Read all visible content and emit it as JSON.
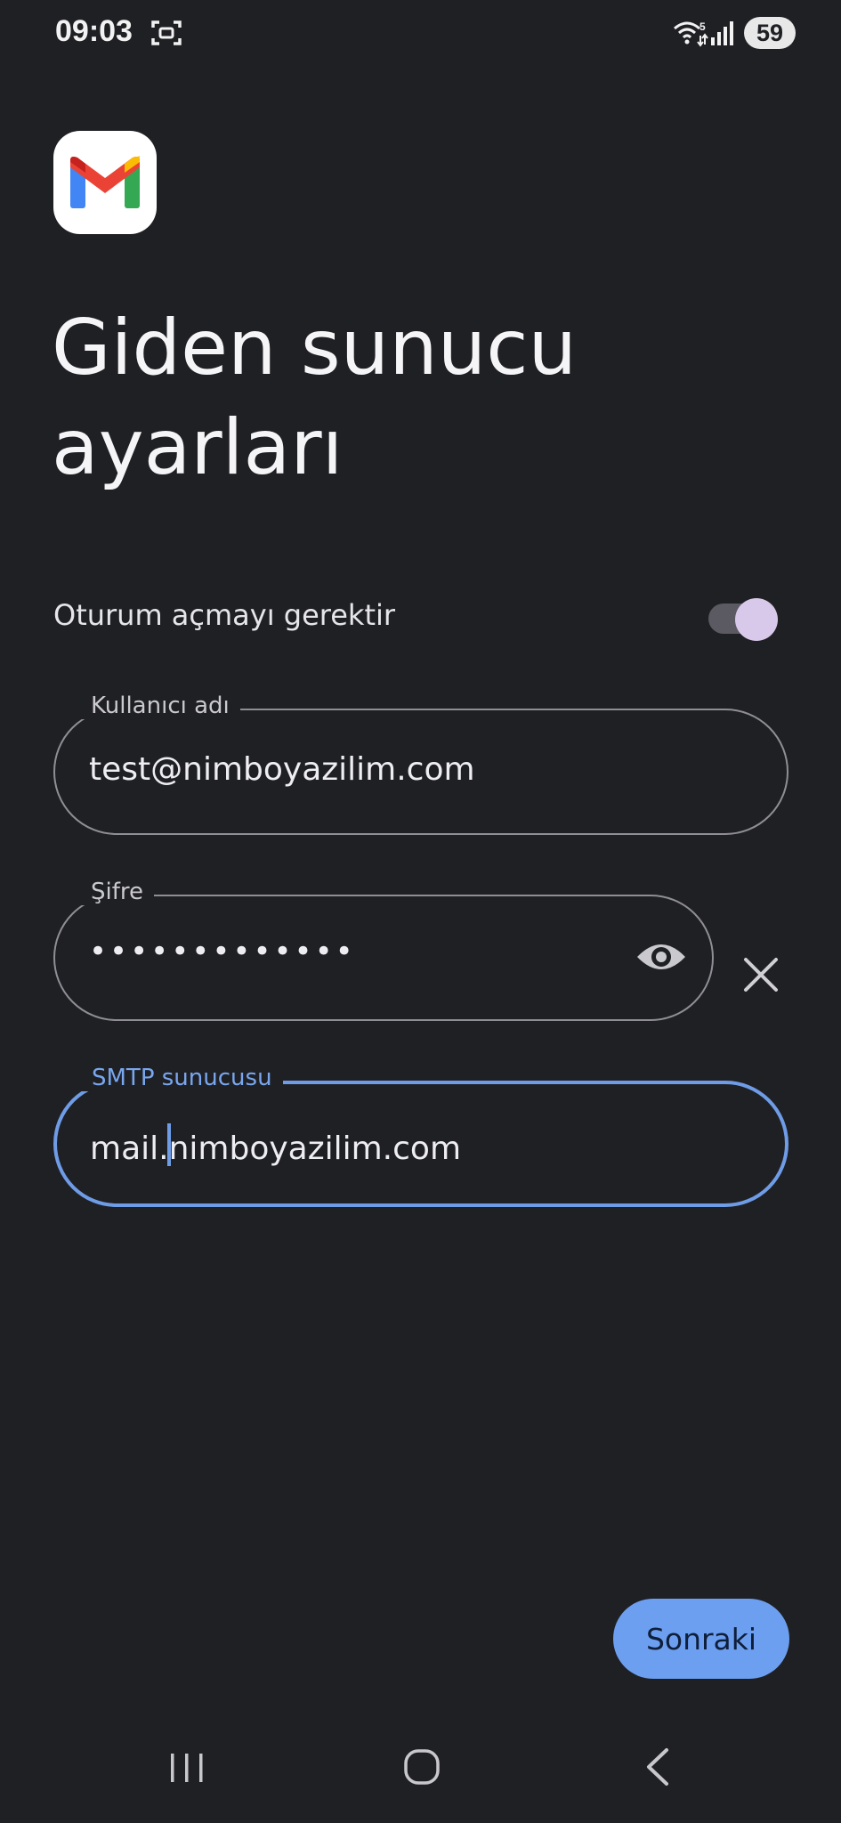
{
  "status_bar": {
    "time": "09:03",
    "battery": "59",
    "wifi_label": "5",
    "icons": [
      "screenshot-icon",
      "wifi-icon",
      "signal-icon",
      "battery-icon"
    ]
  },
  "app": {
    "logo": "gmail-logo"
  },
  "page": {
    "title": "Giden sunucu ayarları"
  },
  "auth_toggle": {
    "label": "Oturum açmayı gerektir",
    "enabled": true
  },
  "fields": {
    "username": {
      "label": "Kullanıcı adı",
      "value": "test@nimboyazilim.com"
    },
    "password": {
      "label": "Şifre",
      "value": "•••••••••••••"
    },
    "smtp": {
      "label": "SMTP sunucusu",
      "value_before_cursor": "mail.",
      "value_after_cursor": "nimboyazilim.com"
    }
  },
  "actions": {
    "next_label": "Sonraki"
  },
  "colors": {
    "background": "#1f2024",
    "accent": "#6d9ff0",
    "focus_border": "#6f9ce6",
    "toggle_thumb": "#d8c9ea"
  }
}
